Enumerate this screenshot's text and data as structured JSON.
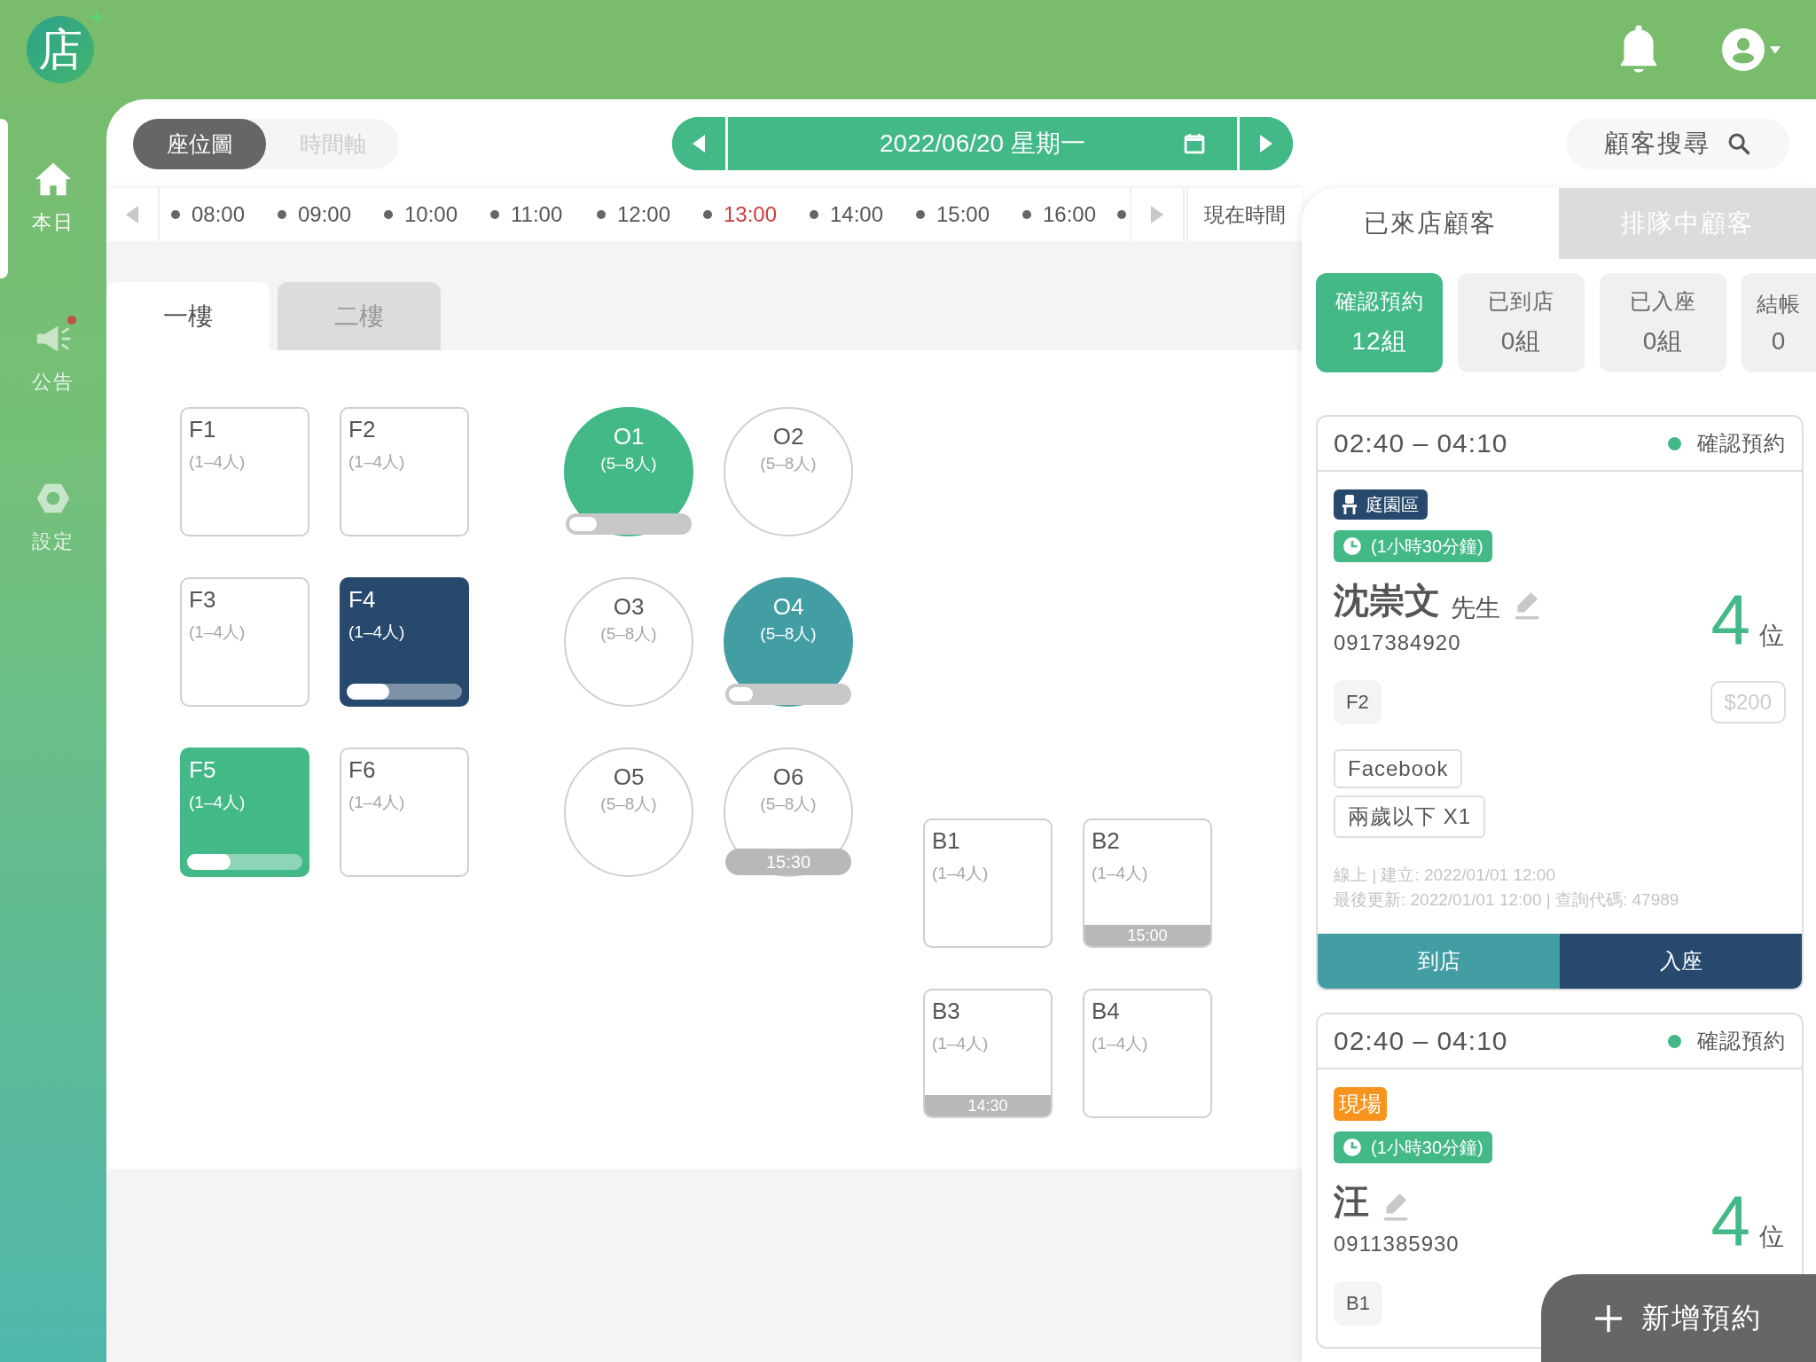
{
  "header": {
    "logo": "店"
  },
  "sidebar": {
    "items": [
      {
        "label": "本日",
        "selected": true,
        "badge": false
      },
      {
        "label": "公告",
        "selected": false,
        "badge": true
      },
      {
        "label": "設定",
        "selected": false,
        "badge": false
      }
    ]
  },
  "view_tabs": [
    {
      "label": "座位圖",
      "selected": true
    },
    {
      "label": "時間軸",
      "selected": false
    }
  ],
  "date_picker": {
    "value": "2022/06/20 星期一"
  },
  "customer_search": {
    "label": "顧客搜尋"
  },
  "timeline": {
    "times": [
      {
        "label": "08:00",
        "current": false
      },
      {
        "label": "09:00",
        "current": false
      },
      {
        "label": "10:00",
        "current": false
      },
      {
        "label": "11:00",
        "current": false
      },
      {
        "label": "12:00",
        "current": false
      },
      {
        "label": "13:00",
        "current": true
      },
      {
        "label": "14:00",
        "current": false
      },
      {
        "label": "15:00",
        "current": false
      },
      {
        "label": "16:00",
        "current": false
      }
    ],
    "now_button": "現在時間"
  },
  "floors": [
    {
      "label": "一樓",
      "selected": true
    },
    {
      "label": "二樓",
      "selected": false
    }
  ],
  "table_groups": [
    {
      "kind": "square",
      "tables": [
        {
          "name": "F1",
          "capacity": "(1–4人)"
        },
        {
          "name": "F2",
          "capacity": "(1–4人)"
        },
        {
          "name": "F3",
          "capacity": "(1–4人)"
        },
        {
          "name": "F4",
          "capacity": "(1–4人)",
          "color": "#27496d",
          "level": 0.37
        },
        {
          "name": "F5",
          "capacity": "(1–4人)",
          "color": "#42b987",
          "level": 0.38
        },
        {
          "name": "F6",
          "capacity": "(1–4人)"
        }
      ]
    },
    {
      "kind": "round",
      "tables": [
        {
          "name": "O1",
          "capacity": "(5–8人)",
          "color": "#42b987",
          "level": 0.23
        },
        {
          "name": "O2",
          "capacity": "(5–8人)"
        },
        {
          "name": "O3",
          "capacity": "(5–8人)"
        },
        {
          "name": "O4",
          "capacity": "(5–8人)",
          "color": "#439ea4",
          "level": 0.2
        },
        {
          "name": "O5",
          "capacity": "(5–8人)"
        },
        {
          "name": "O6",
          "capacity": "(5–8人)",
          "time": "15:30"
        }
      ]
    },
    {
      "kind": "square",
      "tables": [
        {
          "name": "B1",
          "capacity": "(1–4人)"
        },
        {
          "name": "B2",
          "capacity": "(1–4人)",
          "time": "15:00"
        },
        {
          "name": "B3",
          "capacity": "(1–4人)",
          "time": "14:30"
        },
        {
          "name": "B4",
          "capacity": "(1–4人)"
        }
      ]
    }
  ],
  "customer_tabs": [
    {
      "label": "已來店顧客",
      "selected": true
    },
    {
      "label": "排隊中顧客",
      "selected": false
    }
  ],
  "status_filters": [
    {
      "label": "確認預約",
      "count": "12組",
      "selected": true
    },
    {
      "label": "已到店",
      "count": "0組",
      "selected": false
    },
    {
      "label": "已入座",
      "count": "0組",
      "selected": false
    },
    {
      "label": "結帳",
      "count": "0",
      "selected": false
    }
  ],
  "reservations": [
    {
      "time": "02:40 – 04:10",
      "status": "確認預約",
      "color": "#42b987",
      "tags": [
        {
          "kind": "area",
          "label": "庭園區"
        },
        {
          "kind": "duration",
          "label": "(1小時30分鐘)"
        }
      ],
      "name": "沈崇文",
      "title": "先生",
      "phone": "0917384920",
      "guests": "4",
      "guest_unit": "位",
      "table": "F2",
      "price": "$200",
      "labels": [
        "Facebook",
        "兩歲以下 X1"
      ],
      "meta": [
        "線上 | 建立: 2022/01/01 12:00",
        "最後更新: 2022/01/01 12:00 | 查詢代碼: 47989"
      ],
      "actions": [
        {
          "kind": "arrive",
          "label": "到店"
        },
        {
          "kind": "seat",
          "label": "入座"
        }
      ]
    },
    {
      "time": "02:40 – 04:10",
      "status": "確認預約",
      "color": "#42b987",
      "tags": [
        {
          "kind": "walk-in",
          "label": "現場"
        },
        {
          "kind": "duration",
          "label": "(1小時30分鐘)"
        }
      ],
      "name": "汪",
      "phone": "0911385930",
      "guests": "4",
      "guest_unit": "位",
      "table": "B1"
    }
  ],
  "add_button": "新增預約"
}
